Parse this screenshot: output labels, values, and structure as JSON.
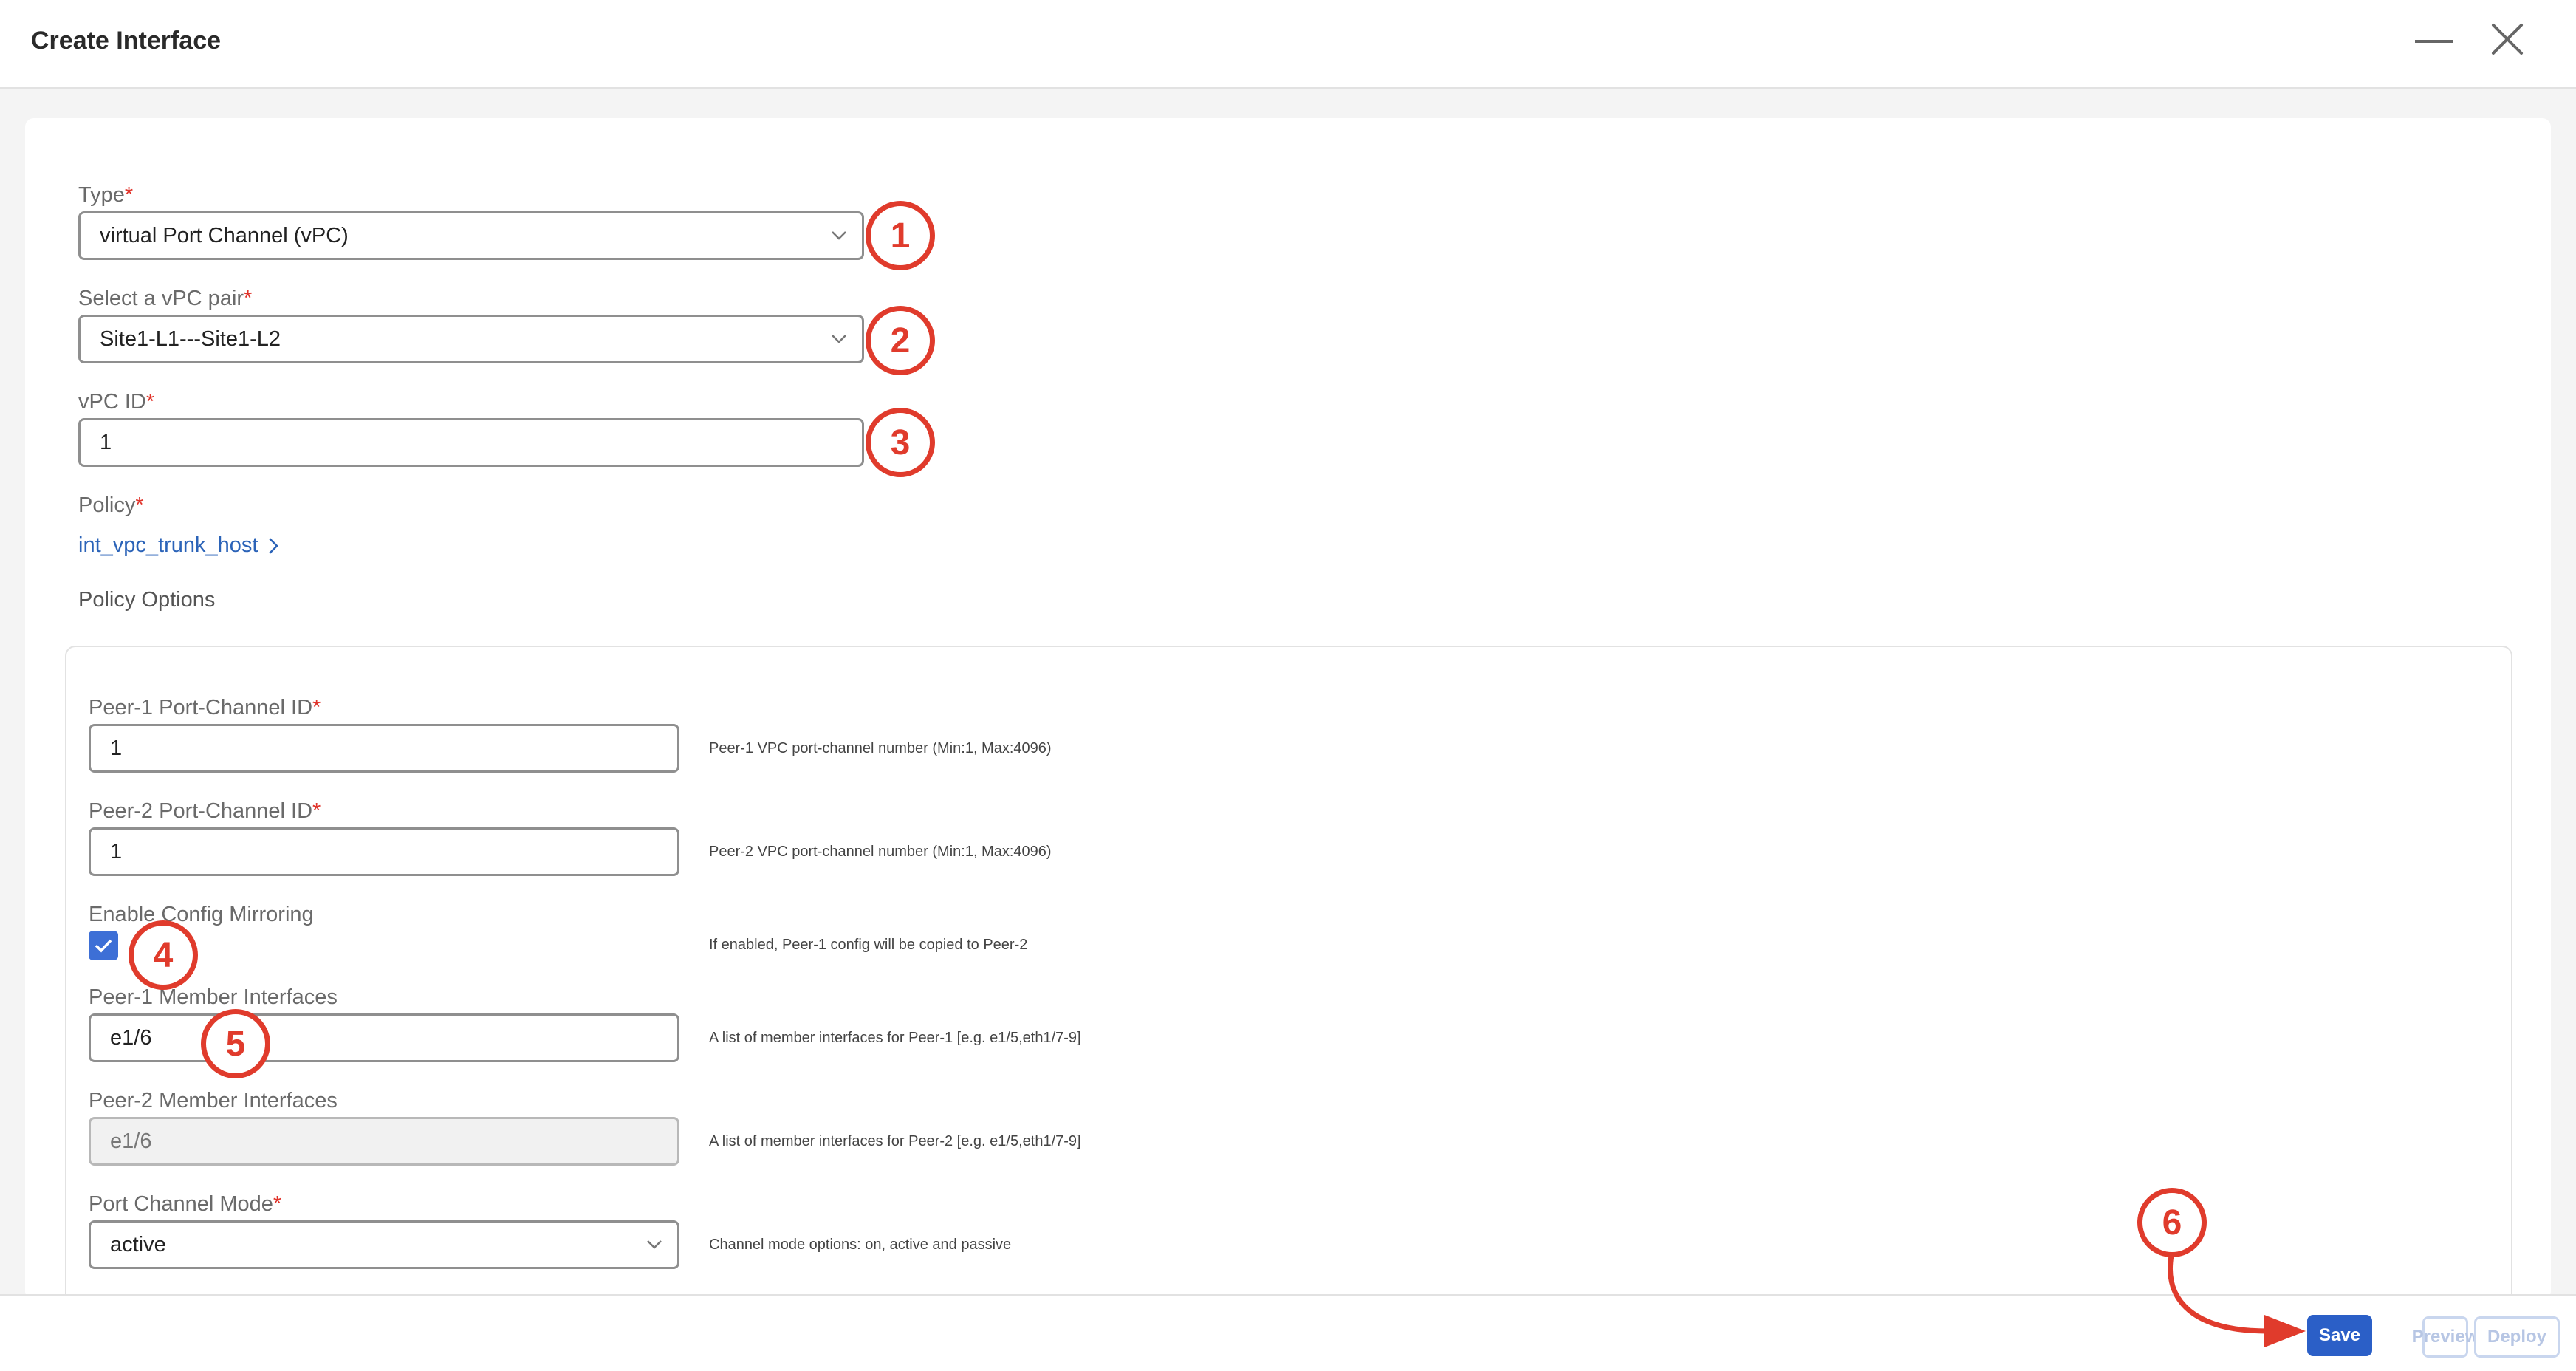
{
  "header": {
    "title": "Create Interface"
  },
  "form": {
    "type": {
      "label": "Type",
      "value": "virtual Port Channel (vPC)"
    },
    "vpc_pair": {
      "label": "Select a vPC pair",
      "value": "Site1-L1---Site1-L2"
    },
    "vpc_id": {
      "label": "vPC ID",
      "value": "1"
    },
    "policy": {
      "label": "Policy",
      "value": "int_vpc_trunk_host"
    },
    "policy_options_label": "Policy Options"
  },
  "policy_options": {
    "peer1_pc_id": {
      "label": "Peer-1 Port-Channel ID",
      "value": "1",
      "hint": "Peer-1 VPC port-channel number (Min:1, Max:4096)"
    },
    "peer2_pc_id": {
      "label": "Peer-2 Port-Channel ID",
      "value": "1",
      "hint": "Peer-2 VPC port-channel number (Min:1, Max:4096)"
    },
    "config_mirroring": {
      "label": "Enable Config Mirroring",
      "checked": true,
      "hint": "If enabled, Peer-1 config will be copied to Peer-2"
    },
    "peer1_members": {
      "label": "Peer-1 Member Interfaces",
      "value": "e1/6",
      "hint": "A list of member interfaces for Peer-1 [e.g. e1/5,eth1/7-9]"
    },
    "peer2_members": {
      "label": "Peer-2 Member Interfaces",
      "value": "e1/6",
      "hint": "A list of member interfaces for Peer-2 [e.g. e1/5,eth1/7-9]"
    },
    "port_channel_mode": {
      "label": "Port Channel Mode",
      "value": "active",
      "hint": "Channel mode options: on, active and passive"
    }
  },
  "callouts": [
    "1",
    "2",
    "3",
    "4",
    "5",
    "6"
  ],
  "footer": {
    "save": "Save",
    "preview": "Preview",
    "deploy": "Deploy"
  },
  "colors": {
    "accent": "#2b5fc7",
    "callout": "#e03b2c",
    "required": "#e0332a",
    "link": "#2b63b8"
  }
}
